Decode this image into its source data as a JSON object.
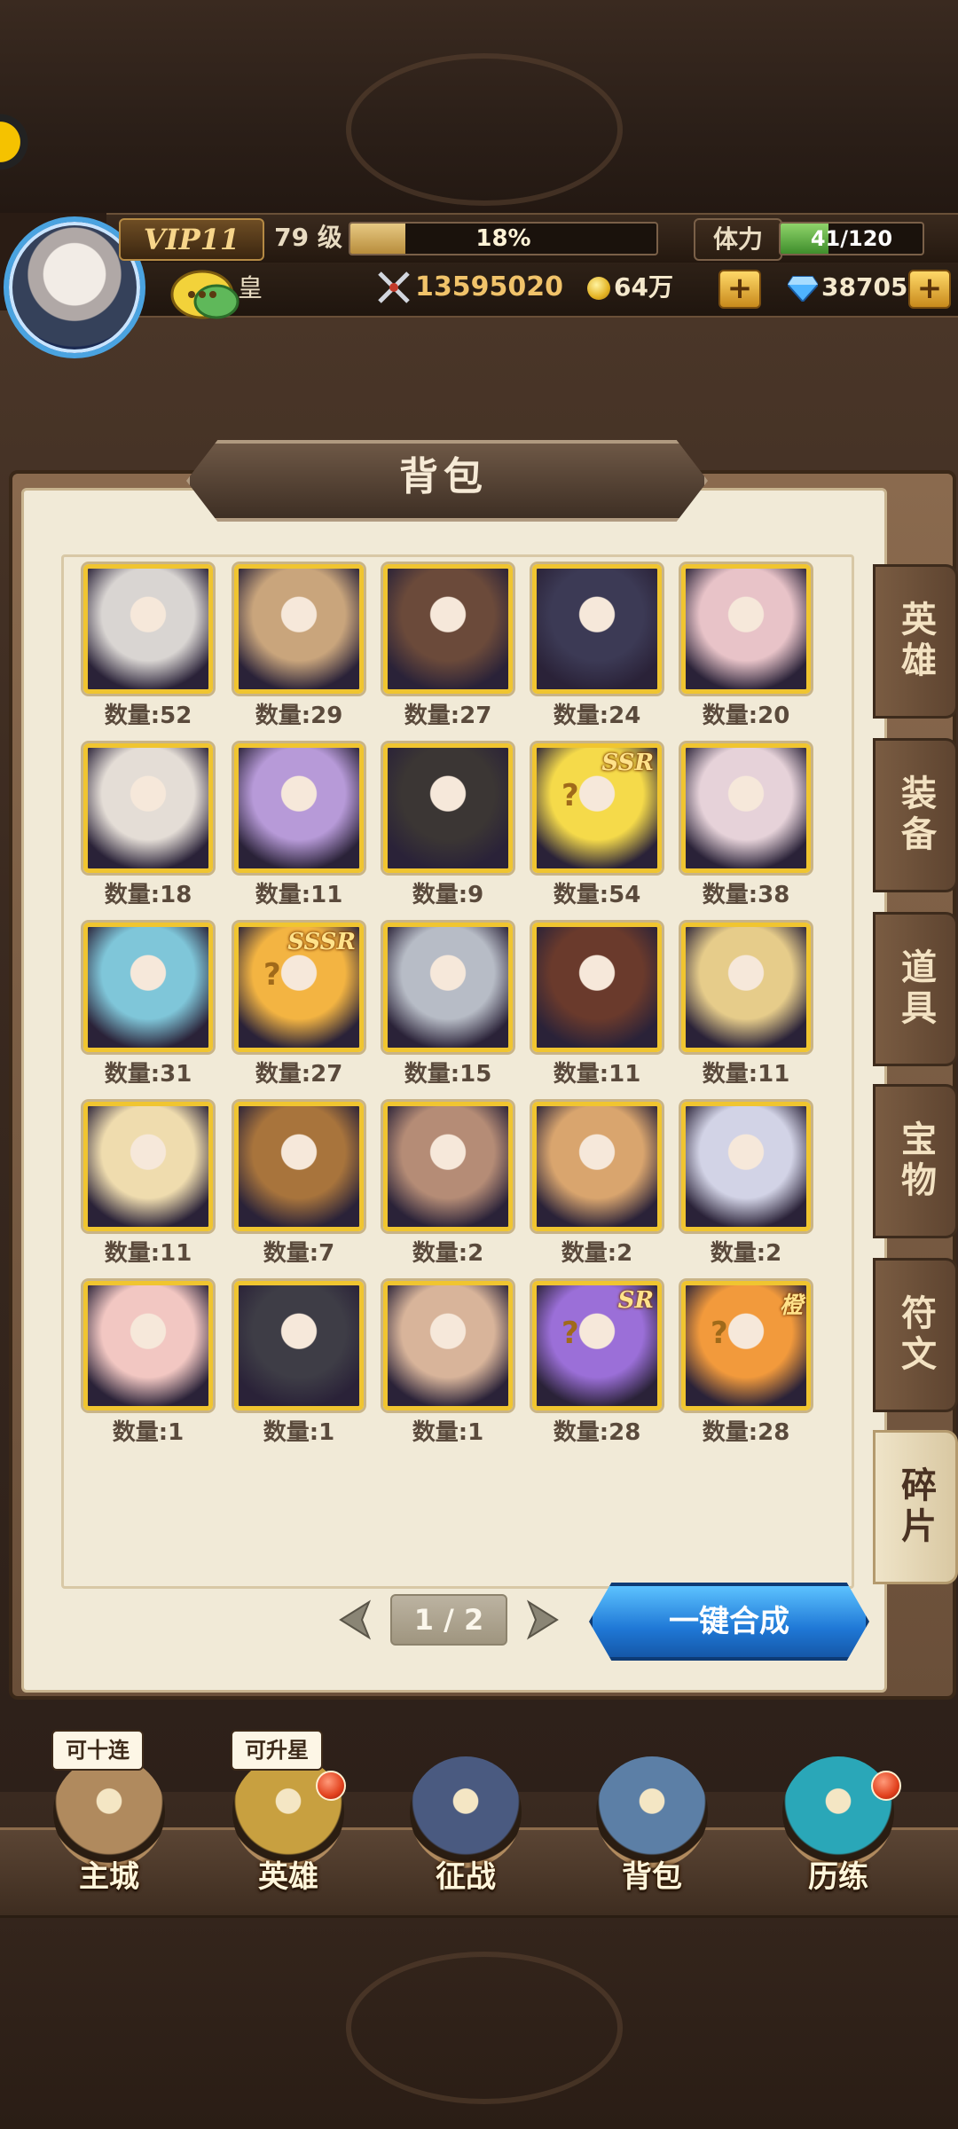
{
  "header": {
    "vip": "VIP11",
    "level": "79 级",
    "exp_percent_text": "18%",
    "exp_fraction": 0.18,
    "stamina_label": "体力",
    "stamina_text": "41/120",
    "stamina_fraction": 0.34,
    "player_name": "皇",
    "combat_power": "13595020",
    "gold": "64万",
    "gems": "38705",
    "plus": "+"
  },
  "panel": {
    "title": "背包",
    "tabs": [
      {
        "label": "英雄",
        "active": false
      },
      {
        "label": "装备",
        "active": false
      },
      {
        "label": "道具",
        "active": false
      },
      {
        "label": "宝物",
        "active": false
      },
      {
        "label": "符文",
        "active": false
      },
      {
        "label": "碎片",
        "active": true
      }
    ],
    "items": [
      {
        "count": "数量:52",
        "color": "#d9d5d2"
      },
      {
        "count": "数量:29",
        "color": "#c9a57c"
      },
      {
        "count": "数量:27",
        "color": "#6b4a3a"
      },
      {
        "count": "数量:24",
        "color": "#3c3a55"
      },
      {
        "count": "数量:20",
        "color": "#e8c3c8"
      },
      {
        "count": "数量:18",
        "color": "#e4ddd6"
      },
      {
        "count": "数量:11",
        "color": "#b79ad8"
      },
      {
        "count": "数量:9",
        "color": "#3b3634"
      },
      {
        "count": "数量:54",
        "color": "#f5da4a",
        "tag": "SSR"
      },
      {
        "count": "数量:38",
        "color": "#e6d2d9"
      },
      {
        "count": "数量:31",
        "color": "#7fc6d9"
      },
      {
        "count": "数量:27",
        "color": "#f3b442",
        "tag": "SSSR"
      },
      {
        "count": "数量:15",
        "color": "#b7bcc6"
      },
      {
        "count": "数量:11",
        "color": "#6a3a2c"
      },
      {
        "count": "数量:11",
        "color": "#e6cc8a"
      },
      {
        "count": "数量:11",
        "color": "#efdcae"
      },
      {
        "count": "数量:7",
        "color": "#a8743c"
      },
      {
        "count": "数量:2",
        "color": "#b58c76"
      },
      {
        "count": "数量:2",
        "color": "#d9a56e"
      },
      {
        "count": "数量:2",
        "color": "#d2d3e6"
      },
      {
        "count": "数量:1",
        "color": "#f2c7c2"
      },
      {
        "count": "数量:1",
        "color": "#3e3d46"
      },
      {
        "count": "数量:1",
        "color": "#d8b49a"
      },
      {
        "count": "数量:28",
        "color": "#9b6fd8",
        "tag": "SR"
      },
      {
        "count": "数量:28",
        "color": "#f29a3c",
        "tag": "橙"
      }
    ],
    "page": "1 / 2",
    "merge_button": "一键合成"
  },
  "nav": [
    {
      "label": "主城",
      "tag": "可十连",
      "color": "#b08a5e"
    },
    {
      "label": "英雄",
      "tag": "可升星",
      "color": "#c8a040"
    },
    {
      "label": "征战",
      "tag": "",
      "color": "#4a5a80"
    },
    {
      "label": "背包",
      "tag": "",
      "color": "#5c7fa6"
    },
    {
      "label": "历练",
      "tag": "",
      "color": "#2aa7b8"
    }
  ],
  "colors": {
    "accent_gold": "#f0c530",
    "merge_blue": "#1f78d6"
  }
}
